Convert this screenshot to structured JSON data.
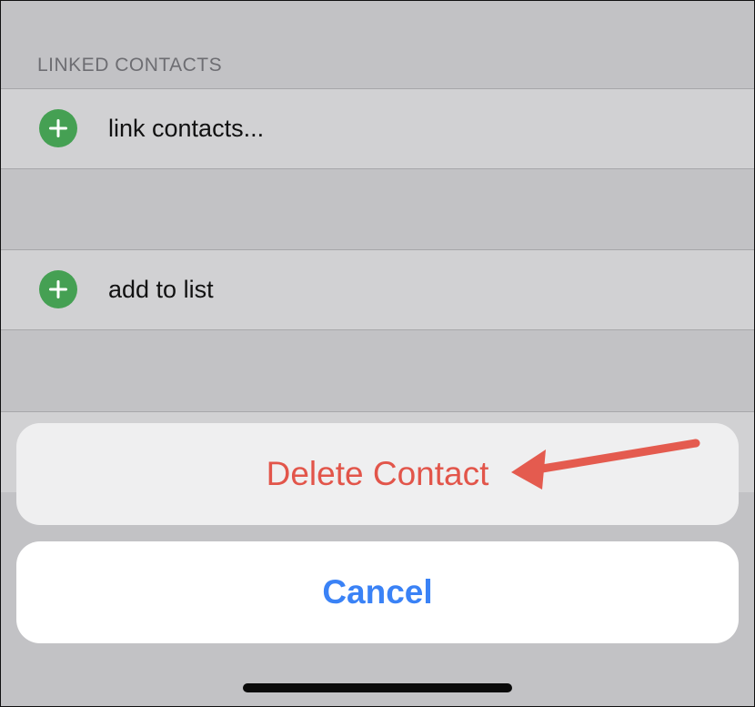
{
  "section": {
    "linked_contacts_header": "LINKED CONTACTS"
  },
  "rows": {
    "link_contacts": "link contacts...",
    "add_to_list": "add to list"
  },
  "action_sheet": {
    "delete_label": "Delete Contact",
    "cancel_label": "Cancel"
  },
  "icons": {
    "row_icon": "plus-circle-icon",
    "annotation": "red-arrow-annotation"
  },
  "colors": {
    "plus_green": "#45a053",
    "destructive_red": "#e2554a",
    "cancel_blue": "#3a82f6",
    "arrow_red": "#e45b4f"
  }
}
